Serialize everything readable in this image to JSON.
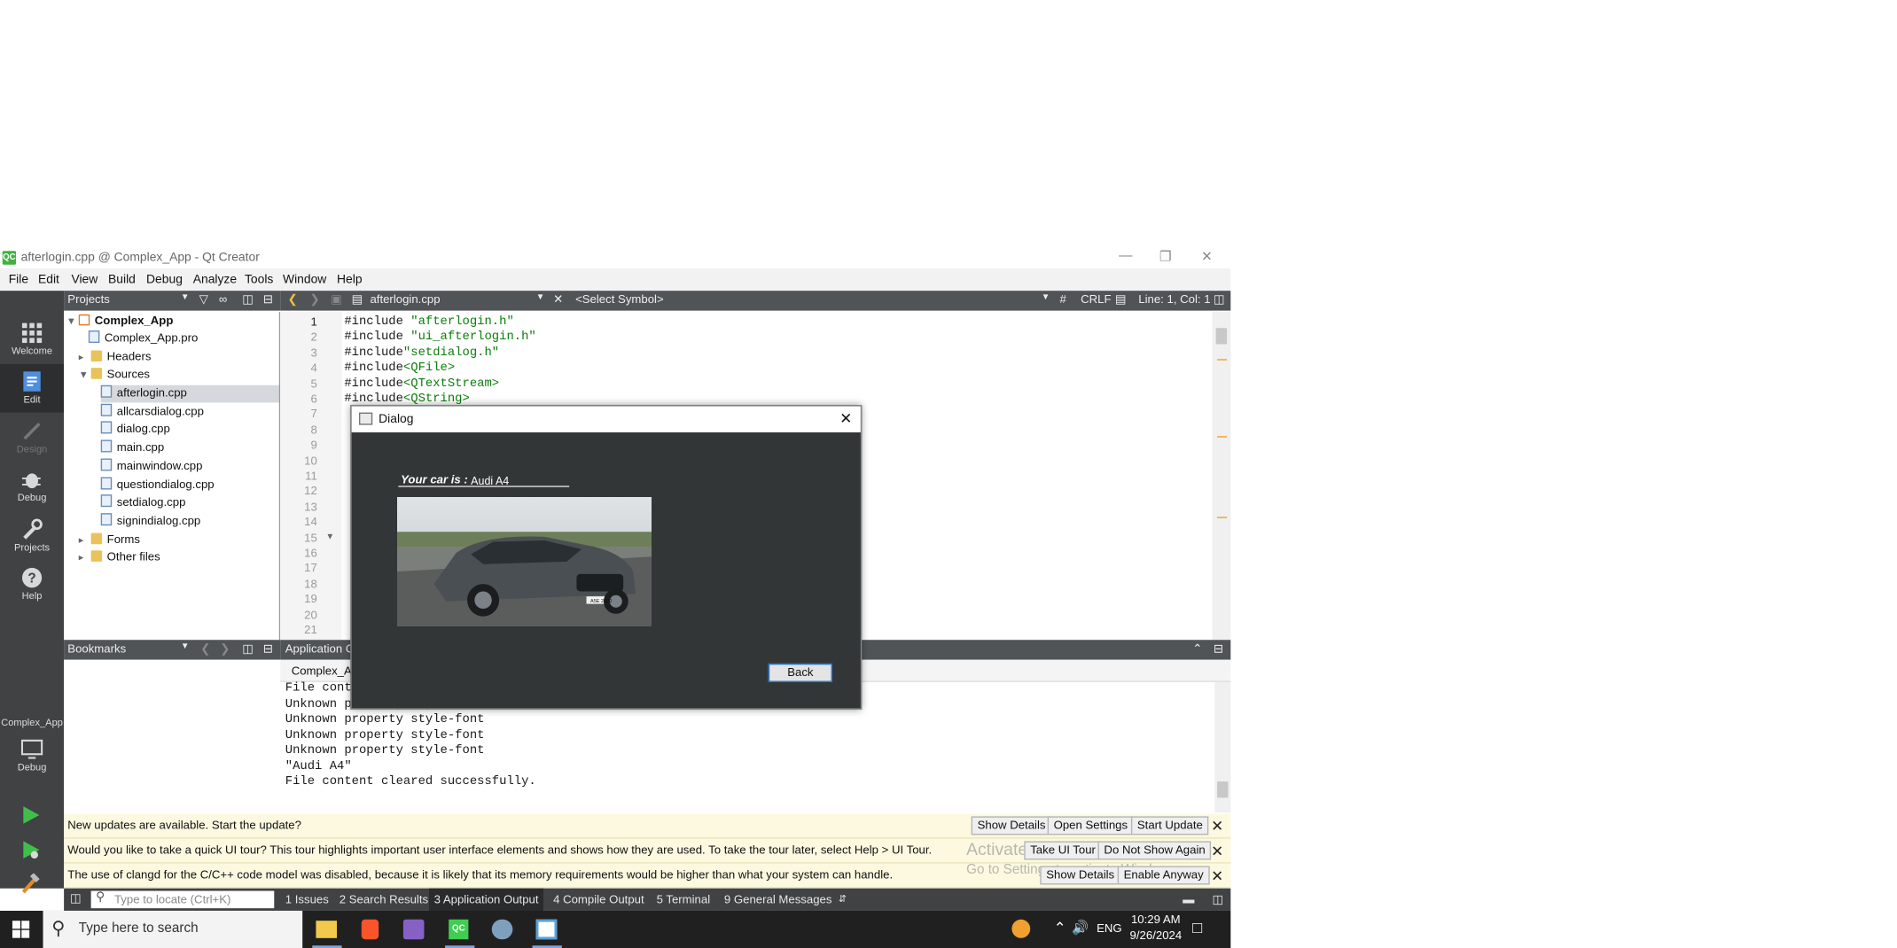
{
  "window": {
    "title": "afterlogin.cpp @ Complex_App - Qt Creator",
    "logo": "QC"
  },
  "menu": [
    "File",
    "Edit",
    "View",
    "Build",
    "Debug",
    "Analyze",
    "Tools",
    "Window",
    "Help"
  ],
  "modes": {
    "welcome": "Welcome",
    "edit": "Edit",
    "design": "Design",
    "debug": "Debug",
    "projects": "Projects",
    "help": "Help",
    "kit_project": "Complex_App",
    "kit_config": "Debug"
  },
  "projects_panel": {
    "title": "Projects",
    "root": "Complex_App",
    "pro_file": "Complex_App.pro",
    "headers": "Headers",
    "sources": "Sources",
    "source_files": [
      "afterlogin.cpp",
      "allcarsdialog.cpp",
      "dialog.cpp",
      "main.cpp",
      "mainwindow.cpp",
      "questiondialog.cpp",
      "setdialog.cpp",
      "signindialog.cpp"
    ],
    "forms": "Forms",
    "other": "Other files"
  },
  "editor": {
    "file": "afterlogin.cpp",
    "symbol": "<Select Symbol>",
    "hash": "#",
    "line_ending": "CRLF",
    "position": "Line: 1, Col: 1",
    "line_numbers": [
      "1",
      "2",
      "3",
      "4",
      "5",
      "6",
      "7",
      "8",
      "9",
      "10",
      "11",
      "12",
      "13",
      "14",
      "15",
      "16",
      "17",
      "18",
      "19",
      "20",
      "21"
    ],
    "code": [
      {
        "pre": "#include ",
        "str": "\"afterlogin.h\""
      },
      {
        "pre": "#include ",
        "str": "\"ui_afterlogin.h\""
      },
      {
        "pre": "#include",
        "str": "\"setdialog.h\""
      },
      {
        "pre": "#include",
        "str": "<QFile>"
      },
      {
        "pre": "#include",
        "str": "<QTextStream>"
      },
      {
        "pre": "#include",
        "str": "<QString>"
      }
    ]
  },
  "bookmarks": {
    "title": "Bookmarks"
  },
  "output": {
    "title": "Application O",
    "tab": "Complex_Ap",
    "lines": [
      "File conte",
      "Unknown property style-font",
      "Unknown property style-font",
      "Unknown property style-font",
      "Unknown property style-font",
      "\"Audi A4\"",
      "File content cleared successfully."
    ]
  },
  "infobars": [
    {
      "message": "New updates are available. Start the update?",
      "buttons": [
        "Show Details",
        "Open Settings",
        "Start Update"
      ]
    },
    {
      "message": "Would you like to take a quick UI tour? This tour highlights important user interface elements and shows how they are used. To take the tour later, select Help > UI Tour.",
      "buttons": [
        "Take UI Tour",
        "Do Not Show Again"
      ]
    },
    {
      "message": "The use of clangd for the C/C++ code model was disabled, because it is likely that its memory requirements would be higher than what your system can handle.",
      "buttons": [
        "Show Details",
        "Enable Anyway"
      ]
    }
  ],
  "watermark": {
    "line1": "Activate Windows",
    "line2": "Go to Settings to activate Windows."
  },
  "statusbar": {
    "locator_placeholder": "Type to locate (Ctrl+K)",
    "tabs": [
      "1  Issues",
      "2  Search Results",
      "3  Application Output",
      "4  Compile Output",
      "5  Terminal",
      "9  General Messages"
    ]
  },
  "dialog": {
    "title": "Dialog",
    "car_label": "Your car is :",
    "car_value": "Audi A4",
    "back": "Back",
    "plate": "A5E 2020"
  },
  "taskbar": {
    "search": "Type here to search",
    "lang": "ENG",
    "time": "10:29 AM",
    "date": "9/26/2024"
  }
}
